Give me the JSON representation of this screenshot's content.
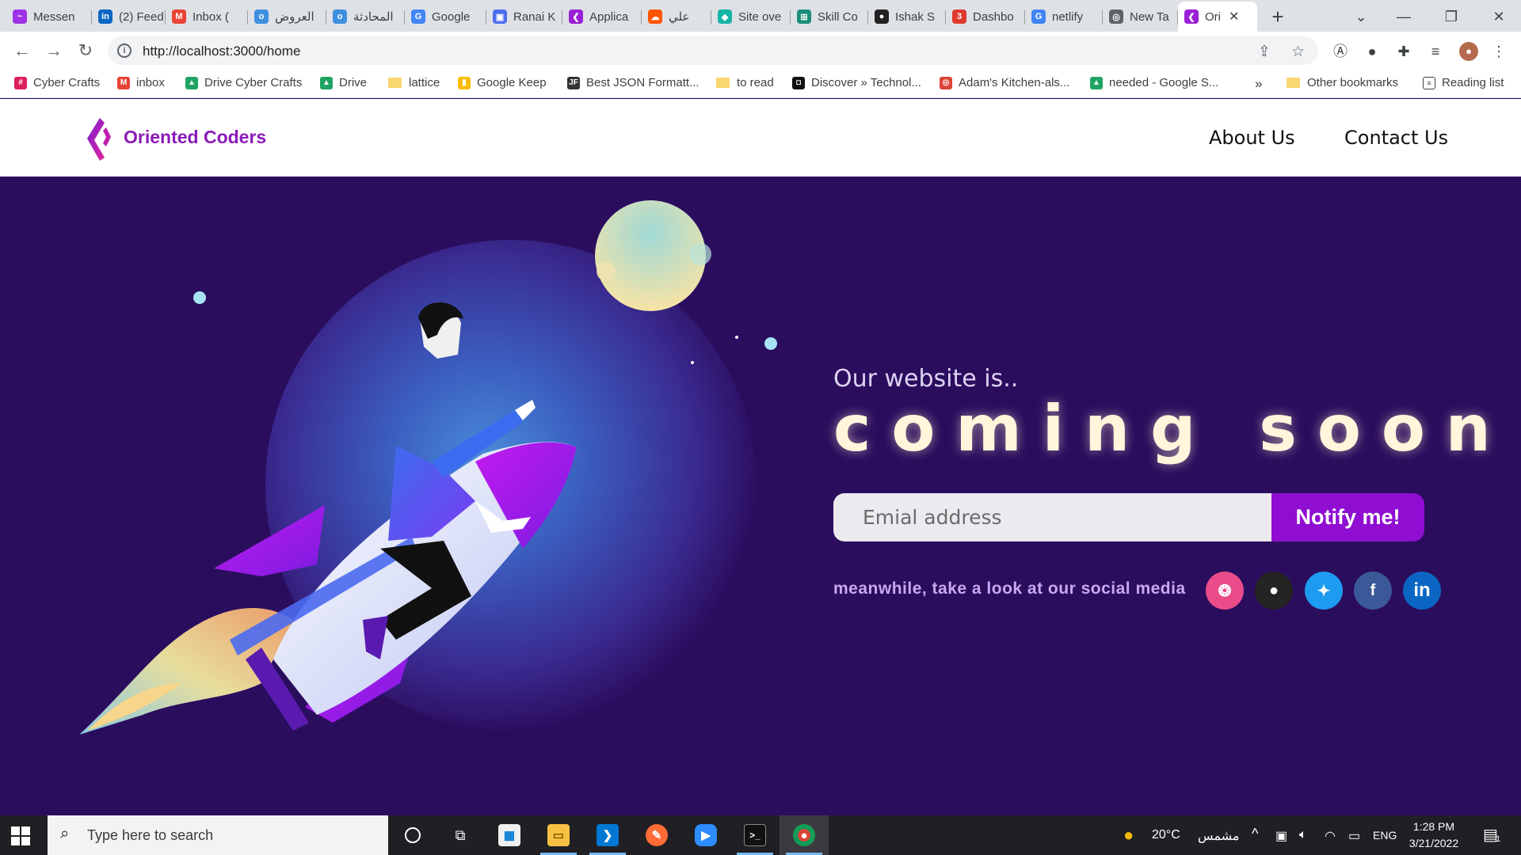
{
  "browser": {
    "tabs": [
      {
        "label": "Messen",
        "icon": "messenger-icon",
        "color": "#a032e8",
        "glyph": "~"
      },
      {
        "label": "(2) Feed",
        "icon": "linkedin-icon",
        "color": "#0a66c2",
        "glyph": "in"
      },
      {
        "label": "Inbox (",
        "icon": "gmail-icon",
        "color": "#ea4335",
        "glyph": "M"
      },
      {
        "label": "العروض",
        "icon": "circle-app-icon",
        "color": "#3d8fe0",
        "glyph": "o"
      },
      {
        "label": "المحادثة",
        "icon": "circle-app-icon",
        "color": "#3d8fe0",
        "glyph": "o"
      },
      {
        "label": "Google",
        "icon": "google-translate-icon",
        "color": "#4285f4",
        "glyph": "G"
      },
      {
        "label": "Ranai K",
        "icon": "camera-icon",
        "color": "#4e6ef2",
        "glyph": "▣"
      },
      {
        "label": "Applica",
        "icon": "oriented-coders-icon",
        "color": "#9b1fd6",
        "glyph": "❮"
      },
      {
        "label": "علي",
        "icon": "soundcloud-icon",
        "color": "#ff5500",
        "glyph": "☁"
      },
      {
        "label": "Site ove",
        "icon": "netlify-icon",
        "color": "#15b5a6",
        "glyph": "◆"
      },
      {
        "label": "Skill Co",
        "icon": "skill-icon",
        "color": "#1d8f7a",
        "glyph": "⊞"
      },
      {
        "label": "Ishak S",
        "icon": "github-icon",
        "color": "#222222",
        "glyph": "●"
      },
      {
        "label": "Dashbo",
        "icon": "dashboard-icon",
        "color": "#e03a2f",
        "glyph": "3"
      },
      {
        "label": "netlify",
        "icon": "google-icon",
        "color": "#4285f4",
        "glyph": "G"
      },
      {
        "label": "New Ta",
        "icon": "chrome-icon",
        "color": "#5f6368",
        "glyph": "◎"
      },
      {
        "label": "Ori",
        "icon": "oriented-coders-icon",
        "color": "#9b1fd6",
        "glyph": "❮"
      }
    ],
    "url": "http://localhost:3000/home",
    "bookmarks": [
      {
        "label": "Cyber Crafts",
        "icon": "slack-icon",
        "color": "#e01e5a",
        "glyph": "#"
      },
      {
        "label": "inbox",
        "icon": "gmail-icon",
        "color": "#ea4335",
        "glyph": "M"
      },
      {
        "label": "Drive Cyber Crafts",
        "icon": "google-drive-icon",
        "color": "#1fa463",
        "glyph": "▲"
      },
      {
        "label": "Drive",
        "icon": "google-drive-icon",
        "color": "#1fa463",
        "glyph": "▲"
      },
      {
        "label": "lattice",
        "icon": "folder-icon",
        "color": "#f9d56e",
        "glyph": ""
      },
      {
        "label": "Google Keep",
        "icon": "google-keep-icon",
        "color": "#fbbc04",
        "glyph": "▮"
      },
      {
        "label": "Best JSON Formatt...",
        "icon": "jsonformatter-icon",
        "color": "#333333",
        "glyph": "JF"
      },
      {
        "label": "to read",
        "icon": "folder-icon",
        "color": "#f9d56e",
        "glyph": ""
      },
      {
        "label": "Discover » Technol...",
        "icon": "discover-icon",
        "color": "#111111",
        "glyph": "◘"
      },
      {
        "label": "Adam's Kitchen-als...",
        "icon": "chrome-icon",
        "color": "#db4437",
        "glyph": "◎"
      },
      {
        "label": "needed - Google S...",
        "icon": "google-drive-icon",
        "color": "#1fa463",
        "glyph": "▲"
      }
    ],
    "overflow": "»",
    "other_bookmarks": "Other bookmarks",
    "reading_list": "Reading list"
  },
  "site": {
    "brand": "Oriented Coders",
    "nav": {
      "about": "About Us",
      "contact": "Contact Us"
    },
    "tagline": "Our website is..",
    "headline": "coming soon",
    "email_placeholder": "Emial address",
    "notify_label": "Notify me!",
    "social_text": "meanwhile, take a look at our social media",
    "socials": [
      {
        "name": "dribbble",
        "color": "#ea4c89",
        "glyph": "❂"
      },
      {
        "name": "github",
        "color": "#242424",
        "glyph": "●"
      },
      {
        "name": "twitter",
        "color": "#1d9bf0",
        "glyph": "✦"
      },
      {
        "name": "facebook",
        "color": "#3b5998",
        "glyph": "f"
      },
      {
        "name": "linkedin",
        "color": "#0a66c2",
        "glyph": "in"
      }
    ]
  },
  "taskbar": {
    "search_placeholder": "Type here to search",
    "weather": "20°C",
    "weather_desc": "مشمس",
    "language": "ENG",
    "time": "1:28 PM",
    "date": "3/21/2022",
    "notification_count": "1"
  }
}
